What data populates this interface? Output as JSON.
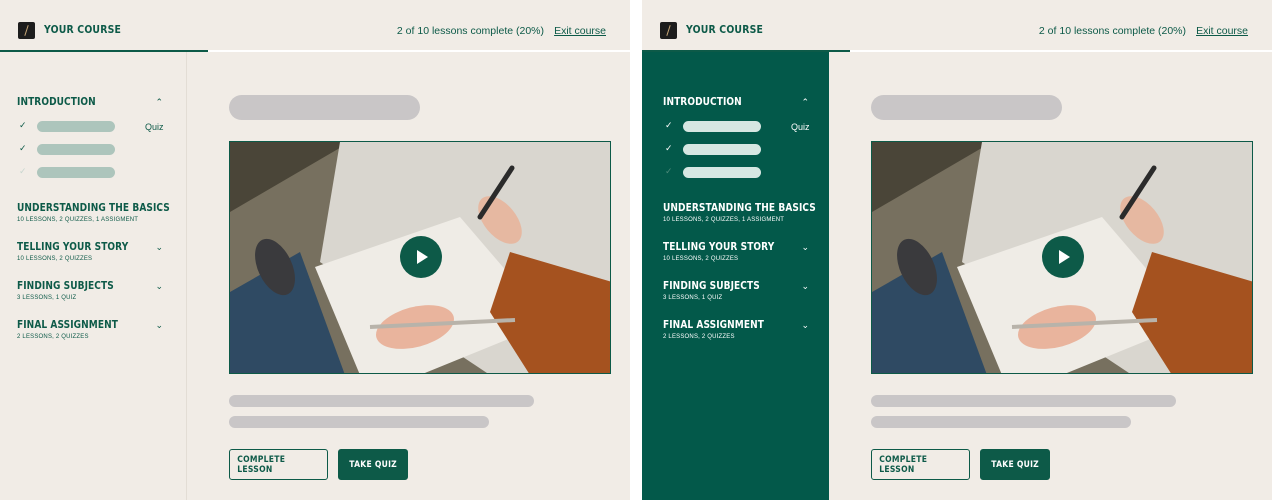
{
  "header": {
    "course_title": "YOUR COURSE",
    "progress_text": "2 of 10 lessons complete (20%)",
    "exit_link": "Exit course"
  },
  "sidebar": {
    "sections": [
      {
        "title": "INTRODUCTION",
        "subtitle": "",
        "expanded": true,
        "chevron": "chevron-up-icon"
      },
      {
        "title": "UNDERSTANDING THE BASICS",
        "subtitle": "10 LESSONS, 2 QUIZZES, 1 ASSIGMENT",
        "expanded": false,
        "chevron": "chevron-down-icon"
      },
      {
        "title": "TELLING YOUR STORY",
        "subtitle": "10 LESSONS, 2 QUIZZES",
        "expanded": false,
        "chevron": "chevron-down-icon"
      },
      {
        "title": "FINDING SUBJECTS",
        "subtitle": "3 LESSONS, 1 QUIZ",
        "expanded": false,
        "chevron": "chevron-down-icon"
      },
      {
        "title": "FINAL ASSIGNMENT",
        "subtitle": "2 LESSONS, 2 QUIZZES",
        "expanded": false,
        "chevron": "chevron-down-icon"
      }
    ],
    "intro_lessons": [
      {
        "completed": true,
        "tag": "Quiz"
      },
      {
        "completed": true,
        "tag": ""
      },
      {
        "completed": false,
        "tag": ""
      }
    ]
  },
  "main": {
    "complete_button": "COMPLETE LESSON",
    "quiz_button": "TAKE QUIZ"
  },
  "colors": {
    "brand": "#0d5a48",
    "sidebar_highlight": "#03594a",
    "background": "#f1ece6",
    "placeholder": "#c9c6c7"
  },
  "icons": {
    "check": "check-icon",
    "play": "play-icon",
    "logo": "course-logo-icon"
  }
}
